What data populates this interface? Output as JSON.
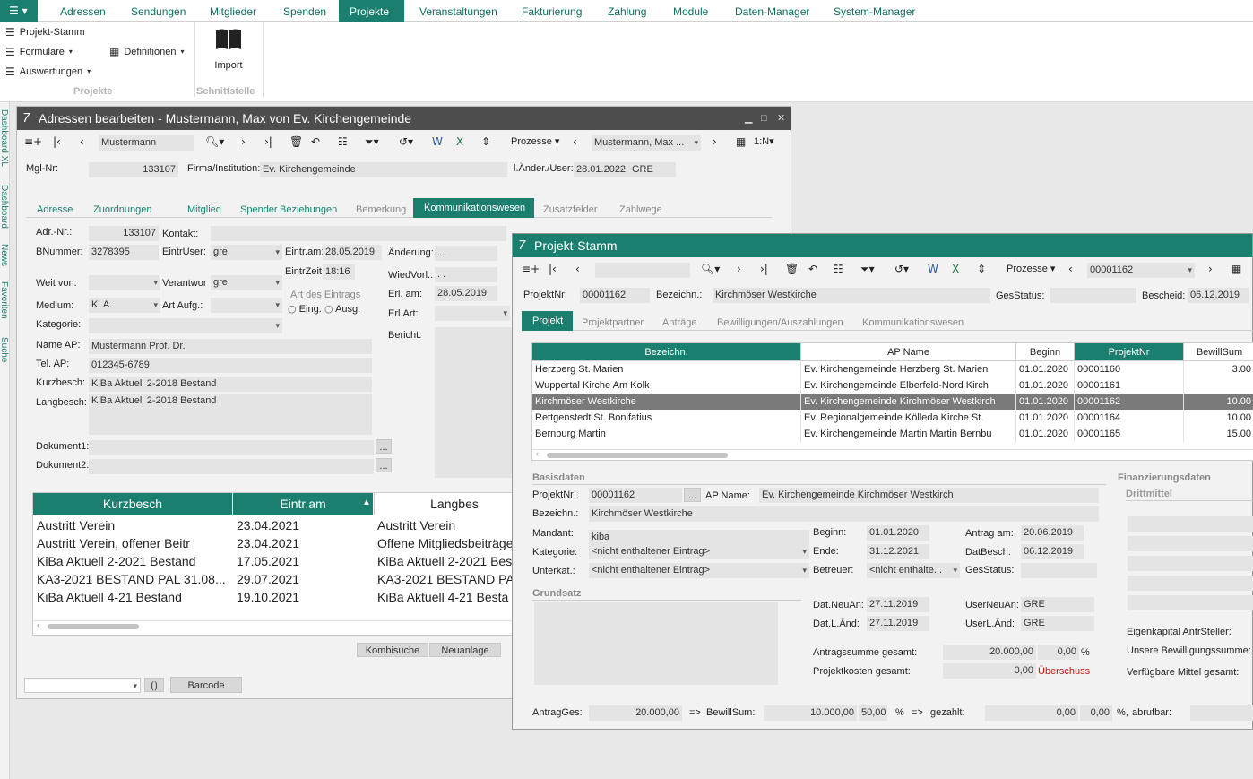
{
  "menubar": {
    "tabs": [
      "Adressen",
      "Sendungen",
      "Mitglieder",
      "Spenden",
      "Projekte",
      "Veranstaltungen",
      "Fakturierung",
      "Zahlung",
      "Module",
      "Daten-Manager",
      "System-Manager"
    ],
    "active": "Projekte"
  },
  "ribbon": {
    "projekt_stamm": "Projekt-Stamm",
    "formulare": "Formulare",
    "definitionen": "Definitionen",
    "auswertungen": "Auswertungen",
    "import": "Import",
    "group_projekte": "Projekte",
    "group_schnittstelle": "Schnittstelle"
  },
  "sidetabs": [
    "Dashboard XL",
    "Dashboard",
    "News",
    "Favoriten",
    "Suche"
  ],
  "winA": {
    "title": "Adressen bearbeiten - Mustermann, Max von Ev. Kirchengemeinde",
    "toolbar": {
      "search_value": "Mustermann",
      "prozesse": "Prozesse",
      "record": "Mustermann, Max ...",
      "view": "1:N"
    },
    "header": {
      "mgl_nr_label": "Mgl-Nr:",
      "mgl_nr": "133107",
      "firma_label": "Firma/Institution:",
      "firma": "Ev. Kirchengemeinde",
      "laender_label": "l.Änder./User:",
      "laender_date": "28.01.2022",
      "laender_user": "GRE"
    },
    "tabs": [
      "Adresse",
      "Zuordnungen",
      "Mitglied",
      "Spender",
      "Beziehungen",
      "Bemerkung",
      "Kommunikationswesen",
      "Zusatzfelder",
      "Zahlwege"
    ],
    "active_tab": "Kommunikationswesen",
    "form": {
      "adr_nr_label": "Adr.-Nr.:",
      "adr_nr": "133107",
      "kontakt_label": "Kontakt:",
      "bnummer_label": "BNummer:",
      "bnummer": "3278395",
      "eintruser_label": "EintrUser:",
      "eintruser": "gre",
      "eintram_label": "Eintr.am:",
      "eintram": "28.05.2019",
      "aenderung_label": "Änderung:",
      "aenderung": ". .",
      "eintrzeit_label": "EintrZeit:",
      "eintrzeit": "18:16",
      "wiedvorl_label": "WiedVorl.:",
      "wiedvorl": ". .",
      "weitvon_label": "Weit von:",
      "verantwor_label": "Verantwor",
      "verantwor": "gre",
      "art_label": "Art des Eintrags",
      "eing": "Eing.",
      "ausg": "Ausg.",
      "erlam_label": "Erl. am:",
      "erlam": "28.05.2019",
      "medium_label": "Medium:",
      "medium": "K. A.",
      "artaufg_label": "Art Aufg.:",
      "erlart_label": "Erl.Art:",
      "kategorie_label": "Kategorie:",
      "bericht_label": "Bericht:",
      "name_ap_label": "Name AP:",
      "name_ap": "Mustermann Prof. Dr.",
      "tel_ap_label": "Tel. AP:",
      "tel_ap": "012345-6789",
      "kurzbesch_label": "Kurzbesch:",
      "kurzbesch": "KiBa Aktuell 2-2018 Bestand",
      "langbesch_label": "Langbesch:",
      "langbesch": "KiBa Aktuell 2-2018 Bestand",
      "dok1_label": "Dokument1:",
      "dok2_label": "Dokument2:",
      "ellipsis": "..."
    },
    "grid": {
      "headers": [
        "Kurzbesch",
        "Eintr.am",
        "Langbes"
      ],
      "rows": [
        [
          "Austritt Verein",
          "23.04.2021",
          "Austritt Verein"
        ],
        [
          "Austritt Verein, offener Beitr",
          "23.04.2021",
          "Offene Mitgliedsbeiträge"
        ],
        [
          "KiBa Aktuell 2-2021 Bestand",
          "17.05.2021",
          "KiBa Aktuell 2-2021 Bes"
        ],
        [
          "KA3-2021 BESTAND PAL 31.08...",
          "29.07.2021",
          "KA3-2021 BESTAND PA"
        ],
        [
          "KiBa Aktuell 4-21 Bestand",
          "19.10.2021",
          "KiBa Aktuell 4-21 Besta"
        ]
      ]
    },
    "buttons": {
      "kombisuche": "Kombisuche",
      "neuanlage": "Neuanlage",
      "barcode": "Barcode"
    }
  },
  "winB": {
    "title": "Projekt-Stamm",
    "toolbar": {
      "prozesse": "Prozesse",
      "record": "00001162"
    },
    "header": {
      "projektnr_label": "ProjektNr:",
      "projektnr": "00001162",
      "bezeichn_label": "Bezeichn.:",
      "bezeichn": "Kirchmöser Westkirche",
      "gesstatus_label": "GesStatus:",
      "bescheid_label": "Bescheid:",
      "bescheid": "06.12.2019"
    },
    "tabs": [
      "Projekt",
      "Projektpartner",
      "Anträge",
      "Bewilligungen/Auszahlungen",
      "Kommunikationswesen"
    ],
    "active_tab": "Projekt",
    "grid": {
      "headers": [
        "Bezeichn.",
        "AP Name",
        "Beginn",
        "ProjektNr",
        "BewillSum"
      ],
      "rows": [
        [
          "Herzberg St. Marien",
          "Ev. Kirchengemeinde Herzberg  St. Marien",
          "01.01.2020",
          "00001160",
          "3.00"
        ],
        [
          "Wuppertal Kirche Am Kolk",
          "Ev. Kirchengemeinde Elberfeld-Nord Kirch",
          "01.01.2020",
          "00001161",
          ""
        ],
        [
          "Kirchmöser Westkirche",
          "Ev. Kirchengemeinde Kirchmöser Westkirch",
          "01.01.2020",
          "00001162",
          "10.00"
        ],
        [
          "Rettgenstedt St. Bonifatius",
          "Ev. Regionalgemeinde Kölleda Kirche St.",
          "01.01.2020",
          "00001164",
          "10.00"
        ],
        [
          "Bernburg Martin",
          "Ev. Kirchengemeinde Martin Martin Bernbu",
          "01.01.2020",
          "00001165",
          "15.00"
        ]
      ],
      "selected_index": 2
    },
    "basis": {
      "section": "Basisdaten",
      "projektnr_label": "ProjektNr:",
      "projektnr": "00001162",
      "ap_name_label": "AP Name:",
      "ap_name": "Ev. Kirchengemeinde Kirchmöser Westkirch",
      "bezeichn_label": "Bezeichn.:",
      "bezeichn": "Kirchmöser Westkirche",
      "mandant_label": "Mandant:",
      "mandant": "kiba",
      "kategorie_label": "Kategorie:",
      "kategorie": "<nicht enthaltener Eintrag>",
      "unterkat_label": "Unterkat.:",
      "unterkat": "<nicht enthaltener Eintrag>",
      "beginn_label": "Beginn:",
      "beginn": "01.01.2020",
      "ende_label": "Ende:",
      "ende": "31.12.2021",
      "betreuer_label": "Betreuer:",
      "betreuer": "<nicht enthalte...",
      "antragam_label": "Antrag am:",
      "antragam": "20.06.2019",
      "datbesch_label": "DatBesch:",
      "datbesch": "06.12.2019",
      "gesstatus_label": "GesStatus:",
      "grundsatz": "Grundsatz",
      "datneuan_label": "Dat.NeuAn:",
      "datneuan": "27.11.2019",
      "datlaend_label": "Dat.L.Änd:",
      "datlaend": "27.11.2019",
      "userneuan_label": "UserNeuAn:",
      "userneuan": "GRE",
      "userlaend_label": "UserL.Änd:",
      "userlaend": "GRE",
      "antragssumme_label": "Antragssumme gesamt:",
      "antragssumme": "20.000,00",
      "antragssumme_pct": "0,00",
      "pct": "%",
      "projektkosten_label": "Projektkosten gesamt:",
      "projektkosten": "0,00",
      "ueberschuss": "Überschuss"
    },
    "finanz": {
      "section": "Finanzierungsdaten",
      "drittmittel": "Drittmittel",
      "eigenkapital": "Eigenkapital AntrSteller:",
      "unsere": "Unsere Bewilligungssumme:",
      "verfuegbar": "Verfügbare Mittel gesamt:"
    },
    "footer": {
      "antragges_label": "AntragGes:",
      "antragges": "20.000,00",
      "arrow": "=>",
      "bewillsum_label": "BewillSum:",
      "bewillsum": "10.000,00",
      "bewillsum_pct": "50,00",
      "pct": "%",
      "gezahlt_label": "gezahlt:",
      "gezahlt": "0,00",
      "gezahlt_pct": "0,00",
      "pct2": "%,",
      "abrufbar_label": "abrufbar:"
    }
  },
  "colors": {
    "accent": "#1a7f6e",
    "titlebar_dark": "#4d4d4d",
    "selected_row": "#7a7a7a",
    "warning": "#cc1111"
  }
}
